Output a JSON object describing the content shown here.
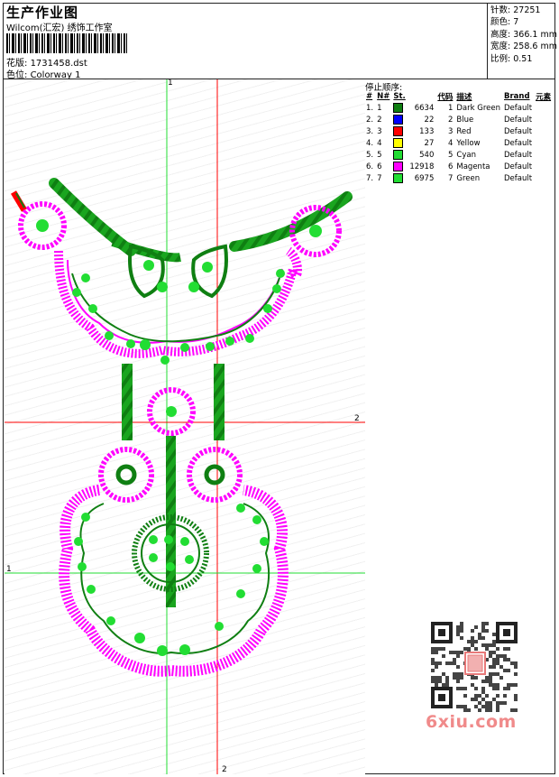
{
  "header": {
    "title": "生产作业图",
    "studio": "Wilcom(汇宏) 绣饰工作室",
    "file_label": "花版:",
    "file_name": "1731458.dst",
    "color_label": "色位:",
    "colorway": "Colorway 1"
  },
  "stats": [
    {
      "label": "针数:",
      "value": "27251"
    },
    {
      "label": "颜色:",
      "value": "7"
    },
    {
      "label": "高度:",
      "value": "366.1 mm"
    },
    {
      "label": "宽度:",
      "value": "258.6 mm"
    },
    {
      "label": "比例:",
      "value": "0.51"
    }
  ],
  "stop_sequence": {
    "title": "停止顺序:",
    "headers": [
      "#",
      "N#",
      "St.",
      "代码",
      "描述",
      "Brand",
      "元素"
    ],
    "rows": [
      {
        "idx": "1.",
        "n": "1",
        "stitches": "6634",
        "code": "1",
        "desc": "Dark Green",
        "brand": "Default",
        "color": "#0f7f12"
      },
      {
        "idx": "2.",
        "n": "2",
        "stitches": "22",
        "code": "2",
        "desc": "Blue",
        "brand": "Default",
        "color": "#0000ff"
      },
      {
        "idx": "3.",
        "n": "3",
        "stitches": "133",
        "code": "3",
        "desc": "Red",
        "brand": "Default",
        "color": "#ff0000"
      },
      {
        "idx": "4.",
        "n": "4",
        "stitches": "27",
        "code": "4",
        "desc": "Yellow",
        "brand": "Default",
        "color": "#ffff00"
      },
      {
        "idx": "5.",
        "n": "5",
        "stitches": "540",
        "code": "5",
        "desc": "Cyan",
        "brand": "Default",
        "color": "#22dd33"
      },
      {
        "idx": "6.",
        "n": "6",
        "stitches": "12918",
        "code": "6",
        "desc": "Magenta",
        "brand": "Default",
        "color": "#ff00ff"
      },
      {
        "idx": "7.",
        "n": "7",
        "stitches": "6975",
        "code": "7",
        "desc": "Green",
        "brand": "Default",
        "color": "#22dd33"
      }
    ]
  },
  "axes": {
    "top": "1",
    "right": "2",
    "left": "1",
    "bottom": "2"
  },
  "watermark": {
    "site": "6xiu.com",
    "stamp": "阿修刺绣"
  }
}
